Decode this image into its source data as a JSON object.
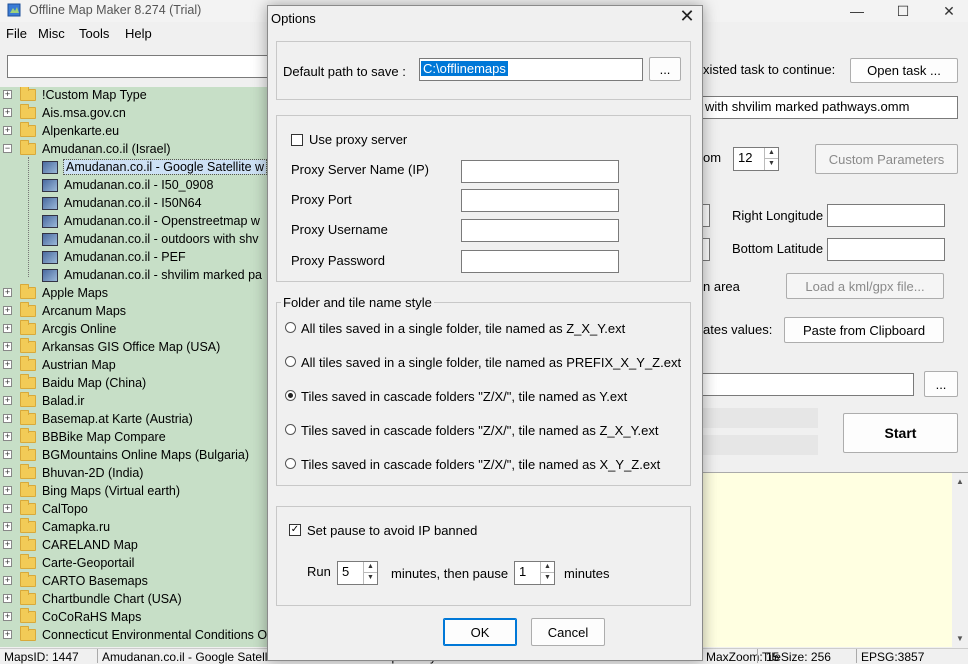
{
  "app": {
    "title": "Offline Map Maker 8.274 (Trial)",
    "window_controls": [
      "—",
      "☐",
      "✕"
    ]
  },
  "menu": [
    "File",
    "Misc",
    "Tools",
    "Help"
  ],
  "search": {
    "value": ""
  },
  "tree": [
    {
      "label": "!Custom Map Type",
      "type": "folder",
      "expander": "+"
    },
    {
      "label": "Ais.msa.gov.cn",
      "type": "folder",
      "expander": "+"
    },
    {
      "label": "Alpenkarte.eu",
      "type": "folder",
      "expander": "+"
    },
    {
      "label": "Amudanan.co.il (Israel)",
      "type": "folder",
      "expander": "−"
    },
    {
      "label": "Amudanan.co.il - Google Satellite w",
      "type": "map",
      "selected": true
    },
    {
      "label": "Amudanan.co.il - I50_0908",
      "type": "map"
    },
    {
      "label": "Amudanan.co.il - I50N64",
      "type": "map"
    },
    {
      "label": "Amudanan.co.il - Openstreetmap w",
      "type": "map"
    },
    {
      "label": "Amudanan.co.il - outdoors with shv",
      "type": "map"
    },
    {
      "label": "Amudanan.co.il - PEF",
      "type": "map"
    },
    {
      "label": "Amudanan.co.il - shvilim marked pa",
      "type": "map"
    },
    {
      "label": "Apple Maps",
      "type": "folder",
      "expander": "+"
    },
    {
      "label": "Arcanum Maps",
      "type": "folder",
      "expander": "+"
    },
    {
      "label": "Arcgis Online",
      "type": "folder",
      "expander": "+"
    },
    {
      "label": "Arkansas GIS Office Map (USA)",
      "type": "folder",
      "expander": "+"
    },
    {
      "label": "Austrian Map",
      "type": "folder",
      "expander": "+"
    },
    {
      "label": "Baidu Map (China)",
      "type": "folder",
      "expander": "+"
    },
    {
      "label": "Balad.ir",
      "type": "folder",
      "expander": "+"
    },
    {
      "label": "Basemap.at Karte (Austria)",
      "type": "folder",
      "expander": "+"
    },
    {
      "label": "BBBike Map Compare",
      "type": "folder",
      "expander": "+"
    },
    {
      "label": "BGMountains Online Maps (Bulgaria)",
      "type": "folder",
      "expander": "+"
    },
    {
      "label": "Bhuvan-2D (India)",
      "type": "folder",
      "expander": "+"
    },
    {
      "label": "Bing Maps (Virtual earth)",
      "type": "folder",
      "expander": "+"
    },
    {
      "label": "CalTopo",
      "type": "folder",
      "expander": "+"
    },
    {
      "label": "Camapka.ru",
      "type": "folder",
      "expander": "+"
    },
    {
      "label": "CARELAND Map",
      "type": "folder",
      "expander": "+"
    },
    {
      "label": "Carte-Geoportail",
      "type": "folder",
      "expander": "+"
    },
    {
      "label": "CARTO Basemaps",
      "type": "folder",
      "expander": "+"
    },
    {
      "label": "Chartbundle Chart (USA)",
      "type": "folder",
      "expander": "+"
    },
    {
      "label": "CoCoRaHS Maps",
      "type": "folder",
      "expander": "+"
    },
    {
      "label": "Connecticut Environmental Conditions O",
      "type": "folder",
      "expander": "+"
    }
  ],
  "main": {
    "existed_task_label": "xisted task to continue:",
    "open_task_button": "Open task ...",
    "task_name_value": "with shvilim marked pathways.omm",
    "zoom_label": "om",
    "zoom_value": "12",
    "custom_params_button": "Custom Parameters",
    "right_longitude_label": "Right Longitude",
    "bottom_latitude_label": "Bottom Latitude",
    "area_label": "n area",
    "load_kml_button": "Load a kml/gpx file...",
    "coords_label": "ates values:",
    "paste_button": "Paste from Clipboard",
    "browse_button": "...",
    "start_button": "Start"
  },
  "status": {
    "maps_id": "MapsID: 1447",
    "map_name": "Amudanan.co.il - Google Satellite with shvilim marked pathways",
    "max_zoom": "MaxZoom: 15",
    "tile_size": "TileSize: 256",
    "epsg": "EPSG:3857"
  },
  "dialog": {
    "title": "Options",
    "close": "✕",
    "default_path_label": "Default path to save :",
    "default_path_value": "C:\\offlinemaps",
    "browse": "...",
    "use_proxy_label": "Use proxy server",
    "use_proxy_checked": false,
    "proxy_server_label": "Proxy Server Name (IP)",
    "proxy_port_label": "Proxy Port",
    "proxy_username_label": "Proxy Username",
    "proxy_password_label": "Proxy Password",
    "tile_style_group": "Folder and tile name style",
    "tile_styles": [
      {
        "label": "All tiles saved in a single folder, tile named as Z_X_Y.ext",
        "selected": false
      },
      {
        "label": "All tiles saved in a single folder, tile named as PREFIX_X_Y_Z.ext",
        "selected": false
      },
      {
        "label": "Tiles saved in cascade folders \"Z/X/\", tile named as Y.ext",
        "selected": true
      },
      {
        "label": "Tiles saved in cascade folders \"Z/X/\", tile named as Z_X_Y.ext",
        "selected": false
      },
      {
        "label": "Tiles saved in cascade folders \"Z/X/\", tile named as X_Y_Z.ext",
        "selected": false
      }
    ],
    "pause_label": "Set pause to avoid IP banned",
    "pause_checked": true,
    "run_label": "Run",
    "run_value": "5",
    "minutes_then_pause_label": "minutes, then pause",
    "pause_value": "1",
    "minutes_label": "minutes",
    "ok_button": "OK",
    "cancel_button": "Cancel"
  }
}
